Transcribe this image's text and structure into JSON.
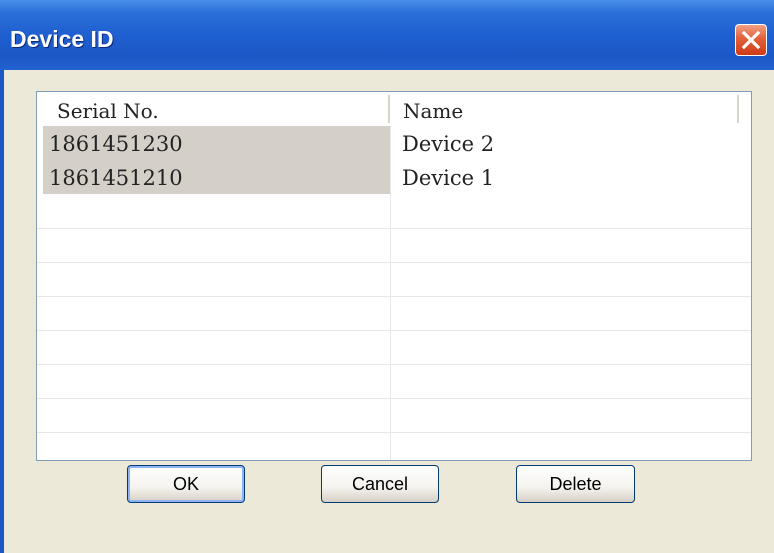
{
  "window": {
    "title": "Device ID"
  },
  "list": {
    "columns": [
      "Serial No.",
      "Name"
    ],
    "rows": [
      {
        "serial": "1861451230",
        "name": "Device 2"
      },
      {
        "serial": "1861451210",
        "name": "Device 1"
      }
    ]
  },
  "buttons": {
    "ok": "OK",
    "cancel": "Cancel",
    "delete": "Delete"
  },
  "icons": {
    "close": "close-icon"
  },
  "colors": {
    "titlebar": "#1f5fd0",
    "close_button": "#e2603a",
    "selected_cell": "#d4d0c8"
  }
}
